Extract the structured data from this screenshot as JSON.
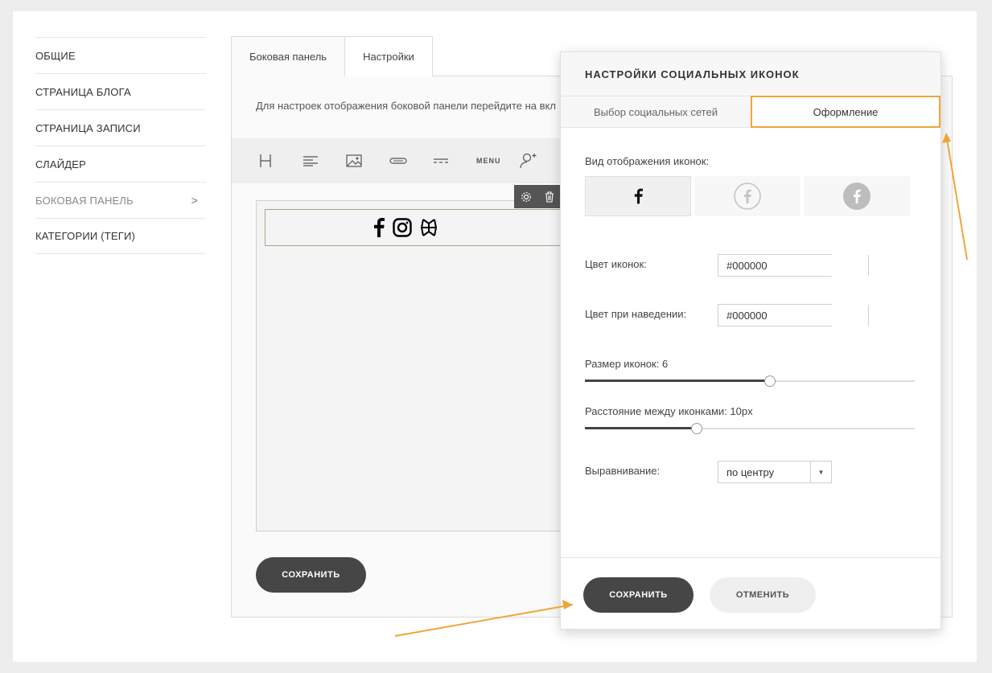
{
  "nav": {
    "items": [
      {
        "label": "ОБЩИЕ"
      },
      {
        "label": "СТРАНИЦА БЛОГА"
      },
      {
        "label": "СТРАНИЦА ЗАПИСИ"
      },
      {
        "label": "СЛАЙДЕР"
      },
      {
        "label": "БОКОВАЯ ПАНЕЛЬ",
        "chevron": ">"
      },
      {
        "label": "КАТЕГОРИИ (ТЕГИ)"
      }
    ]
  },
  "editor": {
    "tabs": [
      {
        "label": "Боковая панель"
      },
      {
        "label": "Настройки"
      }
    ],
    "hint": "Для настроек отображения боковой панели перейдите на вкл",
    "toolbar": {
      "menu_label": "MENU"
    },
    "save_label": "СОХРАНИТЬ"
  },
  "modal": {
    "title": "НАСТРОЙКИ СОЦИАЛЬНЫХ ИКОНОК",
    "tabs": [
      {
        "label": "Выбор социальных сетей"
      },
      {
        "label": "Оформление"
      }
    ],
    "icon_style_label": "Вид отображения иконок:",
    "icon_color_label": "Цвет иконок:",
    "icon_color_value": "#000000",
    "hover_color_label": "Цвет при наведении:",
    "hover_color_value": "#000000",
    "size_label": "Размер иконок: 6",
    "size_fraction": 0.56,
    "spacing_label": "Расстояние между иконками: 10px",
    "spacing_fraction": 0.34,
    "align_label": "Выравнивание:",
    "align_value": "по центру",
    "save_label": "СОХРАНИТЬ",
    "cancel_label": "ОТМЕНИТЬ"
  },
  "colors": {
    "accent_outline": "#f0a43a",
    "dark_button": "#464646",
    "swatch": "#000000"
  }
}
